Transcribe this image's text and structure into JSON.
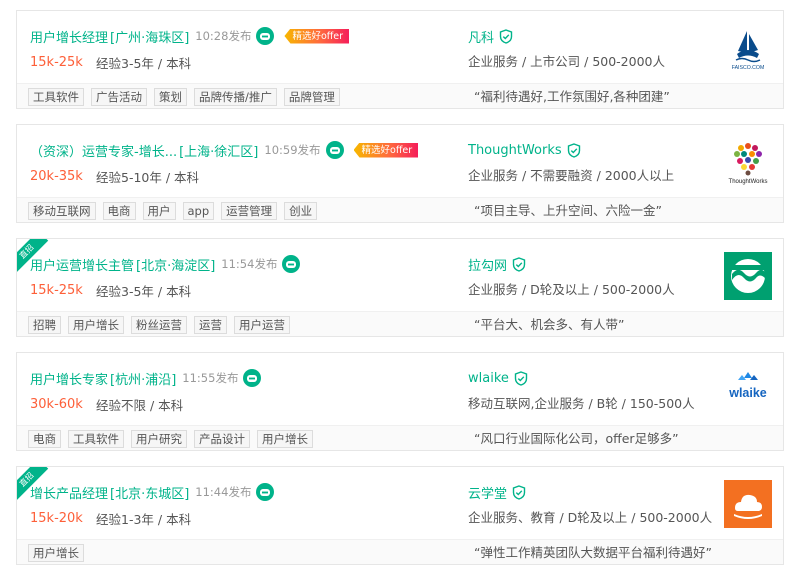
{
  "jobs": [
    {
      "title": "用户增长经理",
      "location": "[广州·海珠区]",
      "time": "10:28发布",
      "offer_badge": "精选好offer",
      "direct_ribbon": "",
      "salary": "15k-25k",
      "requirements": "经验3-5年 / 本科",
      "tags": [
        "工具软件",
        "广告活动",
        "策划",
        "品牌传播/推广",
        "品牌管理"
      ],
      "company": "凡科",
      "company_info": "企业服务 / 上市公司 / 500-2000人",
      "slogan": "“福利待遇好,工作氛围好,各种团建”",
      "logo_text": "FAISCO.COM",
      "logo_icon": "faisco-ship-logo"
    },
    {
      "title": "（资深）运营专家-增长...",
      "location": "[上海·徐汇区]",
      "time": "10:59发布",
      "offer_badge": "精选好offer",
      "direct_ribbon": "",
      "salary": "20k-35k",
      "requirements": "经验5-10年 / 本科",
      "tags": [
        "移动互联网",
        "电商",
        "用户",
        "app",
        "运营管理",
        "创业"
      ],
      "company": "ThoughtWorks",
      "company_info": "企业服务 / 不需要融资 / 2000人以上",
      "slogan": "“项目主导、上升空间、六险一金”",
      "logo_text": "ThoughtWorks",
      "logo_icon": "thoughtworks-dots-logo"
    },
    {
      "title": "用户运营增长主管",
      "location": "[北京·海淀区]",
      "time": "11:54发布",
      "offer_badge": "",
      "direct_ribbon": "直招",
      "salary": "15k-25k",
      "requirements": "经验3-5年 / 本科",
      "tags": [
        "招聘",
        "用户增长",
        "粉丝运营",
        "运营",
        "用户运营"
      ],
      "company": "拉勾网",
      "company_info": "企业服务 / D轮及以上 / 500-2000人",
      "slogan": "“平台大、机会多、有人带”",
      "logo_text": "",
      "logo_icon": "lagou-wave-logo"
    },
    {
      "title": "用户增长专家",
      "location": "[杭州·浦沿]",
      "time": "11:55发布",
      "offer_badge": "",
      "direct_ribbon": "",
      "salary": "30k-60k",
      "requirements": "经验不限 / 本科",
      "tags": [
        "电商",
        "工具软件",
        "用户研究",
        "产品设计",
        "用户增长"
      ],
      "company": "wlaike",
      "company_info": "移动互联网,企业服务 / B轮 / 150-500人",
      "slogan": "“风口行业国际化公司，offer足够多”",
      "logo_text": "wlaike",
      "logo_icon": "wlaike-wordmark-logo"
    },
    {
      "title": "增长产品经理",
      "location": "[北京·东城区]",
      "time": "11:44发布",
      "offer_badge": "",
      "direct_ribbon": "直招",
      "salary": "15k-20k",
      "requirements": "经验1-3年 / 本科",
      "tags": [
        "用户增长"
      ],
      "company": "云学堂",
      "company_info": "企业服务、教育 / D轮及以上 / 500-2000人",
      "slogan": "“弹性工作精英团队大数据平台福利待遇好”",
      "logo_text": "",
      "logo_icon": "yunxuetang-cloud-logo"
    }
  ],
  "colors": {
    "accent": "#00b38a",
    "salary": "#fd5f39",
    "muted": "#999999",
    "lagou_logo_bg": "#00a070",
    "yunxuetang_logo_bg": "#f37021",
    "faisco_blue": "#0a4c8c"
  }
}
